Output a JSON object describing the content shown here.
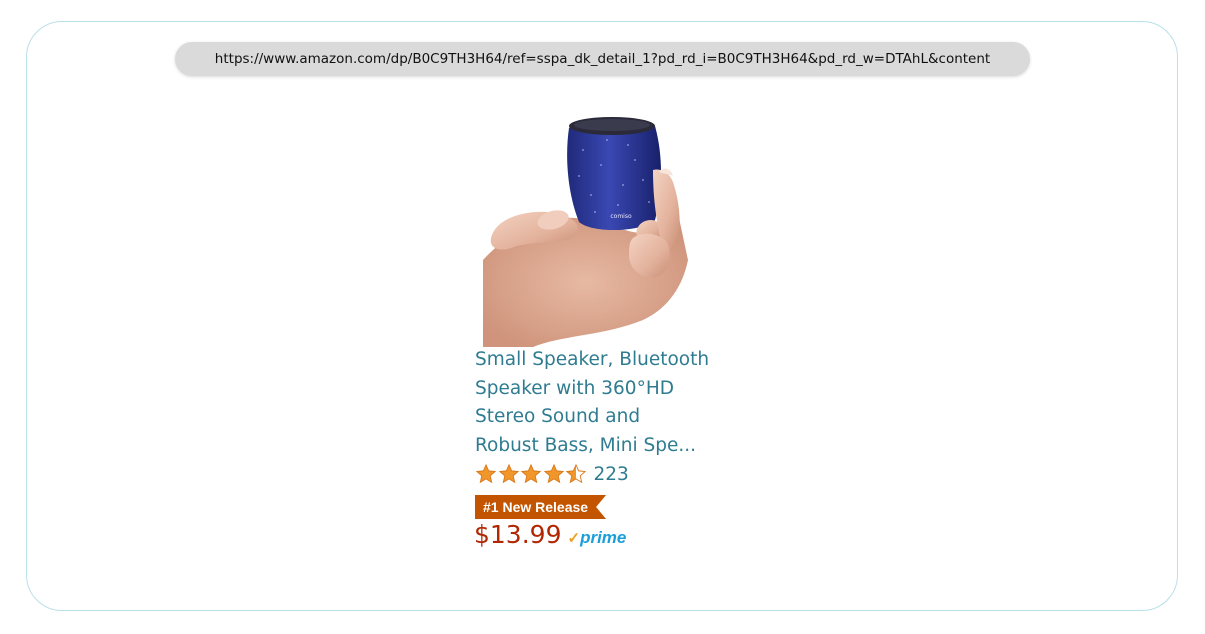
{
  "browser": {
    "url": "https://www.amazon.com/dp/B0C9TH3H64/ref=sspa_dk_detail_1?pd_rd_i=B0C9TH3H64&pd_rd_w=DTAhL&content"
  },
  "product": {
    "image_icon": "speaker-in-hand-image",
    "brand_on_image": "comiso",
    "title_lines": [
      "Small Speaker, Bluetooth",
      "Speaker with 360°HD",
      "Stereo Sound and",
      "Robust Bass, Mini Spe..."
    ],
    "rating": 4.5,
    "rating_max": 5,
    "review_count": "223",
    "badge": "#1 New Release",
    "price": "$13.99",
    "prime_label": "prime"
  },
  "colors": {
    "title_link": "#2f7c91",
    "price": "#b12704",
    "star": "#f0962a",
    "badge_bg": "#c45500",
    "prime_blue": "#1b9fd8",
    "prime_check": "#f0a020",
    "frame_border": "#b9e0e8"
  }
}
